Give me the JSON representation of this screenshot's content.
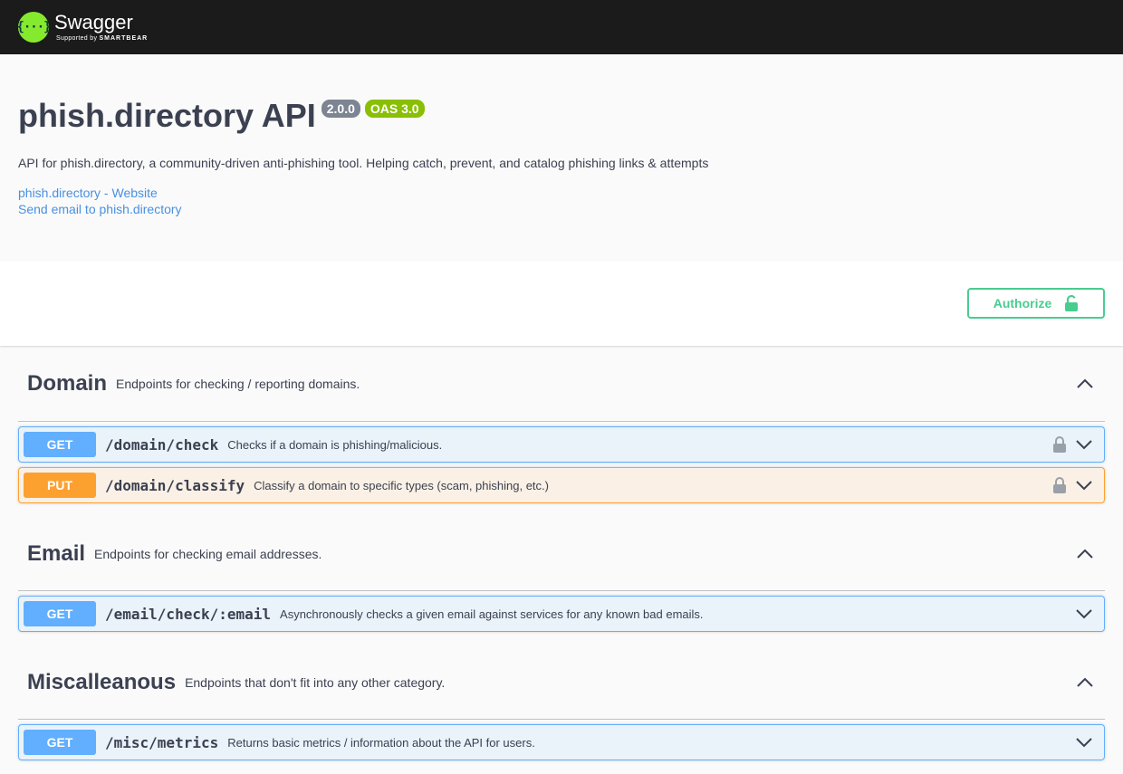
{
  "topbar": {
    "logo_glyph": "{···}",
    "brand": "Swagger",
    "supported_by": "Supported by",
    "sponsor": "SMARTBEAR"
  },
  "info": {
    "title": "phish.directory API",
    "version": "2.0.0",
    "oas": "OAS 3.0",
    "description": "API for phish.directory, a community-driven anti-phishing tool. Helping catch, prevent, and catalog phishing links & attempts",
    "links": {
      "website": "phish.directory - Website",
      "email": "Send email to phish.directory"
    }
  },
  "auth": {
    "authorize_label": "Authorize",
    "icon": "unlock-icon"
  },
  "colors": {
    "get": "#61affe",
    "put": "#fca130",
    "authorize": "#49cc90",
    "oas_badge": "#89bf04",
    "version_badge": "#7d8492"
  },
  "tags": [
    {
      "name": "Domain",
      "description": "Endpoints for checking / reporting domains.",
      "operations": [
        {
          "method": "GET",
          "path": "/domain/check",
          "summary": "Checks if a domain is phishing/malicious.",
          "locked": true
        },
        {
          "method": "PUT",
          "path": "/domain/classify",
          "summary": "Classify a domain to specific types (scam, phishing, etc.)",
          "locked": true
        }
      ]
    },
    {
      "name": "Email",
      "description": "Endpoints for checking email addresses.",
      "operations": [
        {
          "method": "GET",
          "path": "/email/check/:email",
          "summary": "Asynchronously checks a given email against services for any known bad emails.",
          "locked": false
        }
      ]
    },
    {
      "name": "Miscalleanous",
      "description": "Endpoints that don't fit into any other category.",
      "operations": [
        {
          "method": "GET",
          "path": "/misc/metrics",
          "summary": "Returns basic metrics / information about the API for users.",
          "locked": false
        }
      ]
    }
  ]
}
